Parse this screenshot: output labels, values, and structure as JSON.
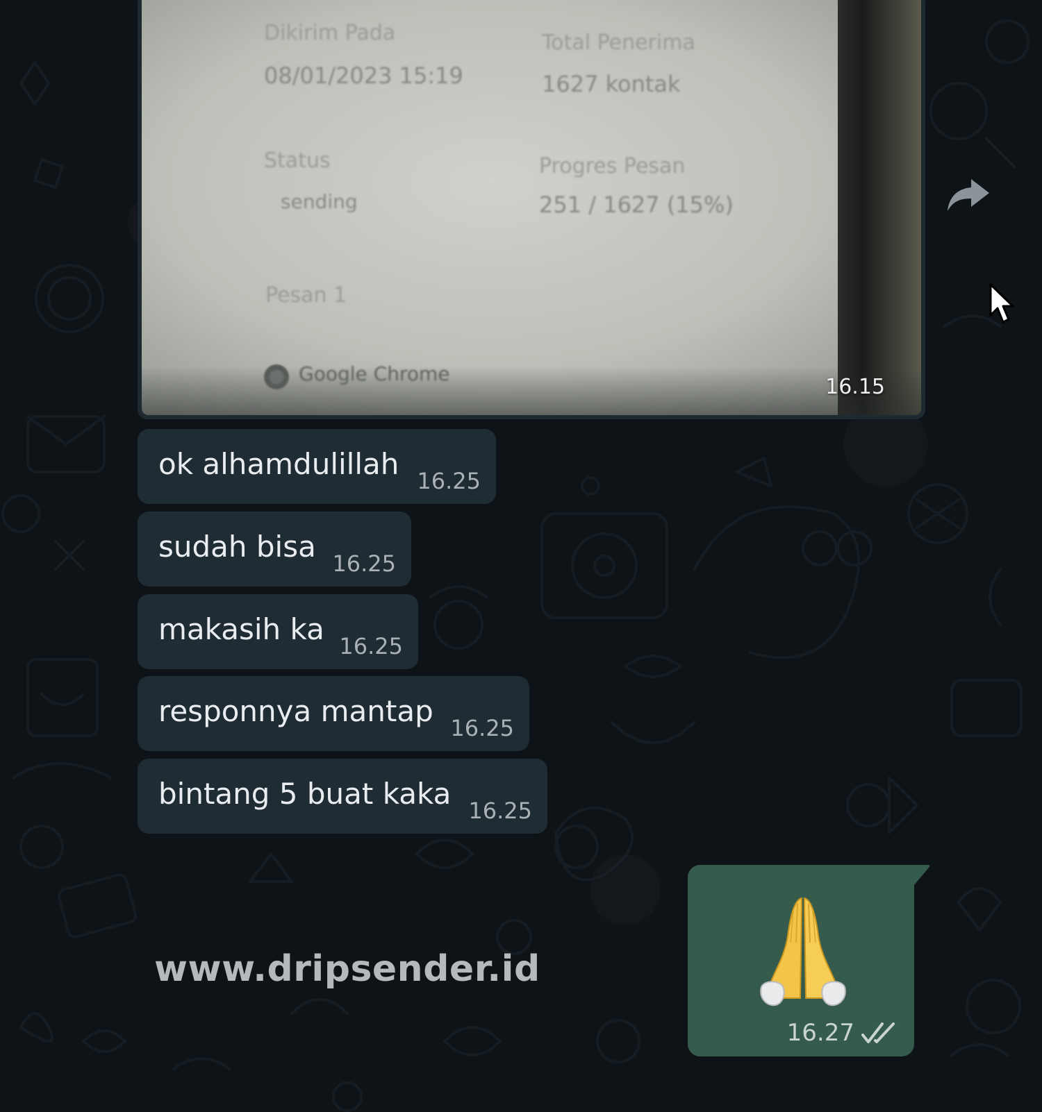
{
  "image_message": {
    "photo_text": {
      "sent_at_label": "Dikirim Pada",
      "sent_at_value": "08/01/2023 15:19",
      "total_label": "Total Penerima",
      "total_value": "1627 kontak",
      "status_label": "Status",
      "status_value": "sending",
      "progress_label": "Progres Pesan",
      "progress_value": "251 / 1627 (15%)",
      "message_label": "Pesan 1",
      "taskbar_app": "Google Chrome"
    },
    "time": "16.15"
  },
  "incoming_messages": [
    {
      "text": "ok alhamdulillah",
      "time": "16.25"
    },
    {
      "text": "sudah bisa",
      "time": "16.25"
    },
    {
      "text": "makasih ka",
      "time": "16.25"
    },
    {
      "text": "responnya mantap",
      "time": "16.25"
    },
    {
      "text": "bintang 5 buat kaka",
      "time": "16.25"
    }
  ],
  "watermark": "www.dripsender.id",
  "outgoing_message": {
    "emoji": "folded-hands-emoji",
    "time": "16.27",
    "status": "double-check-icon"
  },
  "colors": {
    "background": "#0e1317",
    "incoming_bubble": "#202c33",
    "outgoing_bubble": "#355b4d",
    "text_primary": "#e9edef",
    "text_secondary": "#aab1b5"
  }
}
